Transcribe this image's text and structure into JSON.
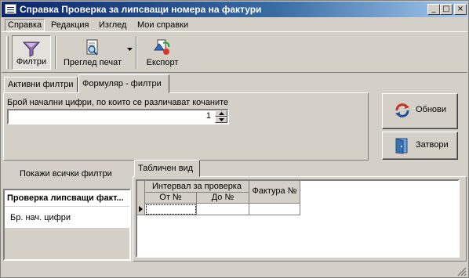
{
  "window": {
    "title": "Справка Проверка за липсващи номера на фактури",
    "minimize": "_",
    "maximize": "□",
    "close": "×"
  },
  "menu": [
    "Справка",
    "Редакция",
    "Изглед",
    "Мои справки"
  ],
  "toolbar": {
    "filters": "Филтри",
    "preview": "Преглед печат",
    "export": "Експорт"
  },
  "tabs": {
    "active_filters": "Активни филтри",
    "form_filters": "Формуляр - филтри",
    "table_view": "Табличен вид"
  },
  "form": {
    "digits_label": "Брой начални цифри, по които се различават кочаните",
    "digits_value": "1"
  },
  "buttons": {
    "refresh": "Обнови",
    "close": "Затвори"
  },
  "left_panel": {
    "show_all": "Покажи всички филтри",
    "group_title": "Проверка липсващи факт...",
    "item": "Бр. нач. цифри"
  },
  "table": {
    "group_header": "Интервал за проверка",
    "col_from": "От №",
    "col_to": "До №",
    "col_invoice": "Фактура №"
  }
}
